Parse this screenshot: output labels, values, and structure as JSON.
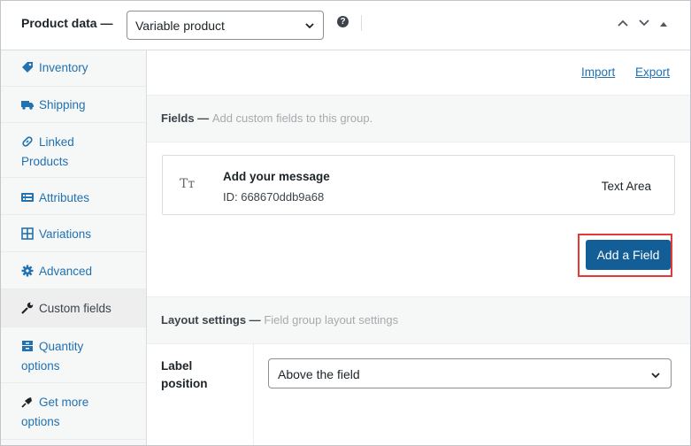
{
  "header": {
    "title": "Product data —",
    "product_type": "Variable product",
    "help_icon_glyph": "?"
  },
  "sidebar": {
    "items": [
      {
        "label": "Inventory",
        "icon": "tag-icon"
      },
      {
        "label": "Shipping",
        "icon": "truck-icon"
      },
      {
        "label": "Linked",
        "label2": "Products",
        "icon": "link-icon"
      },
      {
        "label": "Attributes",
        "icon": "list-icon"
      },
      {
        "label": "Variations",
        "icon": "grid-icon"
      },
      {
        "label": "Advanced",
        "icon": "gear-icon"
      },
      {
        "label": "Custom fields",
        "icon": "wrench-icon",
        "active": true
      },
      {
        "label": "Quantity",
        "label2": "options",
        "icon": "archive-icon"
      },
      {
        "label": "Get more",
        "label2": "options",
        "icon": "plugin-icon"
      }
    ]
  },
  "main": {
    "import_label": "Import",
    "export_label": "Export",
    "fields_section": {
      "title": "Fields —",
      "subtitle": "Add custom fields to this group."
    },
    "field": {
      "icon_glyph": "Tт",
      "name": "Add your message",
      "id": "ID: 668670ddb9a68",
      "type": "Text Area"
    },
    "add_field_label": "Add a Field",
    "layout_section": {
      "title": "Layout settings —",
      "subtitle": "Field group layout settings"
    },
    "label_position": {
      "label_line1": "Label",
      "label_line2": "position",
      "value": "Above the field"
    }
  },
  "colors": {
    "link": "#2271b1",
    "button": "#135e96",
    "highlight": "#e53935"
  }
}
